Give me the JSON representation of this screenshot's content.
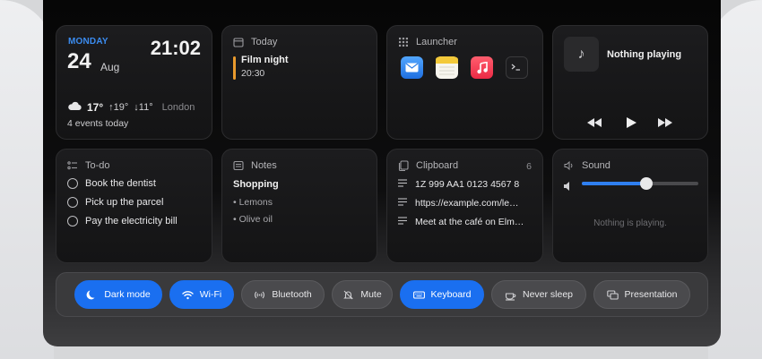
{
  "clock": {
    "day": "MONDAY",
    "date": "24",
    "month": "Aug",
    "time": "21:02",
    "temp": "17°",
    "high": "↑19°",
    "low": "↓11°",
    "city": "London",
    "events": "4 events today"
  },
  "today": {
    "title": "Today",
    "event_title": "Film night",
    "event_time": "20:30",
    "event_color": "#e99a2d"
  },
  "launcher": {
    "title": "Launcher",
    "apps": [
      {
        "name": "mail-app-icon",
        "color": "#2f8ff5"
      },
      {
        "name": "notes-app-icon",
        "color": "#f5d34a"
      },
      {
        "name": "music-app-icon",
        "color": "#f03a4f"
      },
      {
        "name": "terminal-app-icon",
        "color": "#1c1c1e"
      }
    ]
  },
  "now_playing": {
    "status": "Nothing playing",
    "art_icon": "♪"
  },
  "todo": {
    "title": "To-do",
    "items": [
      "Book the dentist",
      "Pick up the parcel",
      "Pay the electricity bill"
    ]
  },
  "notes": {
    "title": "Notes",
    "heading": "Shopping",
    "items": [
      "• Lemons",
      "• Olive oil"
    ]
  },
  "clipboard": {
    "title": "Clipboard",
    "count": "6",
    "items": [
      "1Z 999 AA1 0123 4567 8",
      "https://example.com/le…",
      "Meet at the café on Elm…"
    ]
  },
  "sound": {
    "title": "Sound",
    "volume": 0.55,
    "empty": "Nothing is playing."
  },
  "toggles": [
    {
      "label": "Dark mode",
      "on": true
    },
    {
      "label": "Wi-Fi",
      "on": true
    },
    {
      "label": "Bluetooth",
      "on": false
    },
    {
      "label": "Mute",
      "on": false
    },
    {
      "label": "Keyboard",
      "on": true
    },
    {
      "label": "Never sleep",
      "on": false
    },
    {
      "label": "Presentation",
      "on": false
    }
  ],
  "colors": {
    "accent": "#1a6ff0",
    "day_label": "#3b8cf0"
  }
}
